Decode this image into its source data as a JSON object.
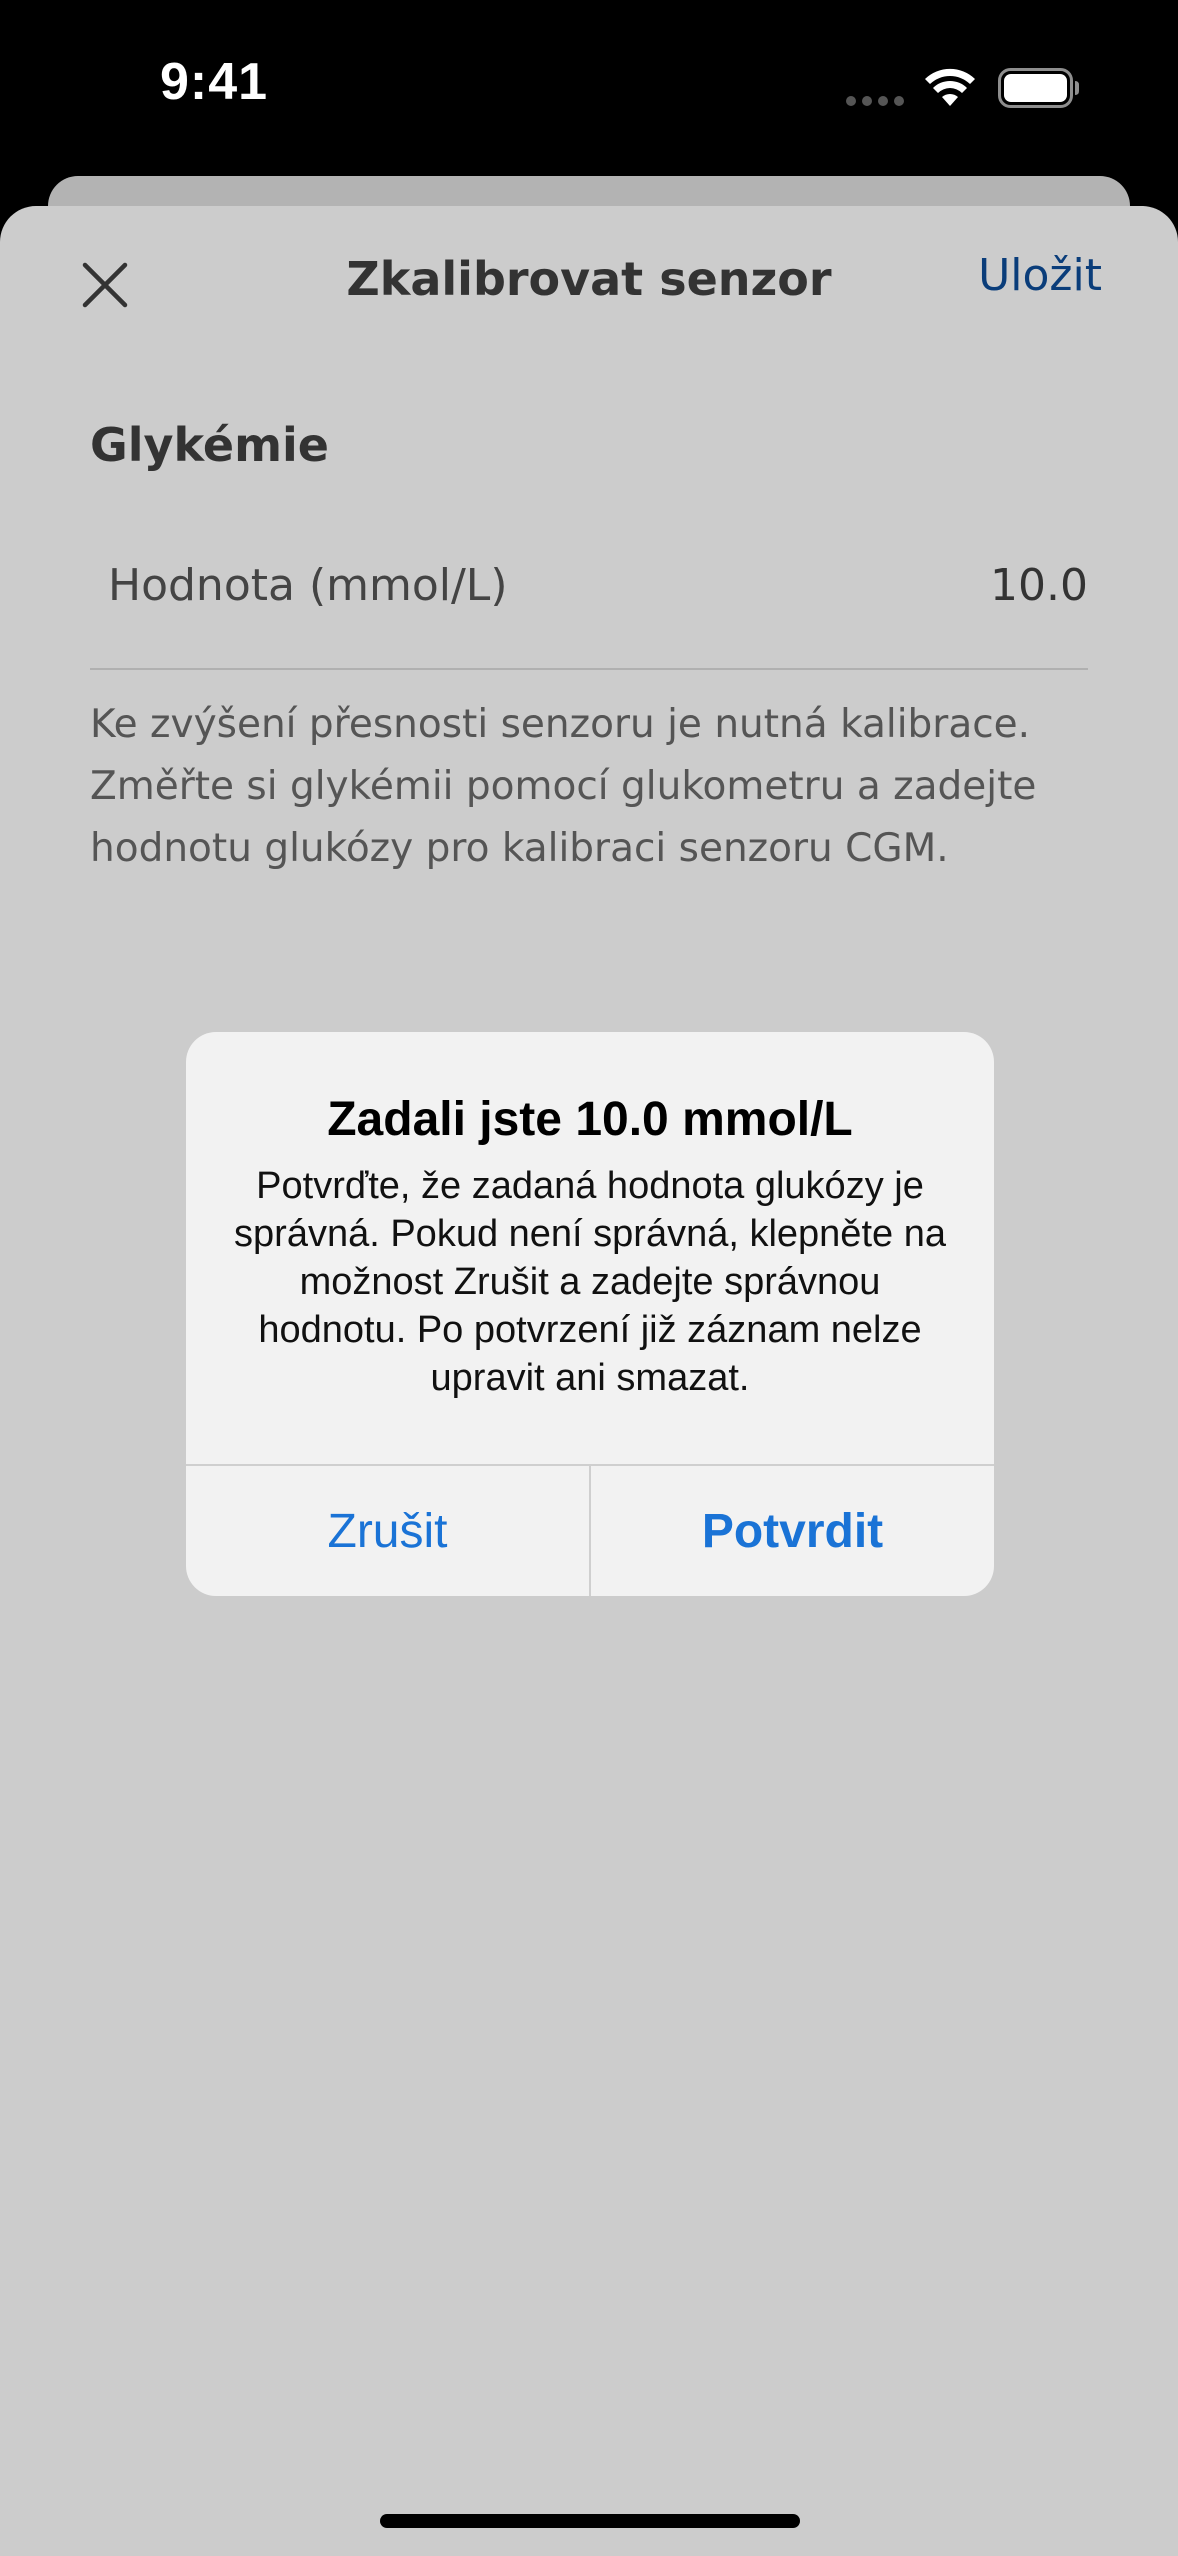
{
  "status_bar": {
    "time": "9:41",
    "signal_icon": "signal-dots-icon",
    "wifi_icon": "wifi-icon",
    "battery_icon": "battery-icon"
  },
  "nav": {
    "close_icon": "close-icon",
    "title": "Zkalibrovat senzor",
    "save_label": "Uložit"
  },
  "form": {
    "section_title": "Glykémie",
    "field_label": "Hodnota (mmol/L)",
    "field_value": "10.0",
    "help_text": "Ke zvýšení přesnosti senzoru je nutná kalibrace. Změřte si glykémii pomocí glukometru a zadejte hodnotu glukózy pro kalibraci senzoru CGM."
  },
  "alert": {
    "title": "Zadali jste 10.0 mmol/L",
    "message": "Potvrďte, že zadaná hodnota glukózy je správná. Pokud není správná, klepněte na možnost Zrušit a zadejte správnou hodnotu. Po potvrzení již záznam nelze upravit ani smazat.",
    "cancel_label": "Zrušit",
    "confirm_label": "Potvrdit"
  },
  "colors": {
    "accent": "#1a73d6",
    "nav_link": "#0a3d7a",
    "overlay_background": "#cccccc",
    "alert_background": "#f2f2f2"
  }
}
